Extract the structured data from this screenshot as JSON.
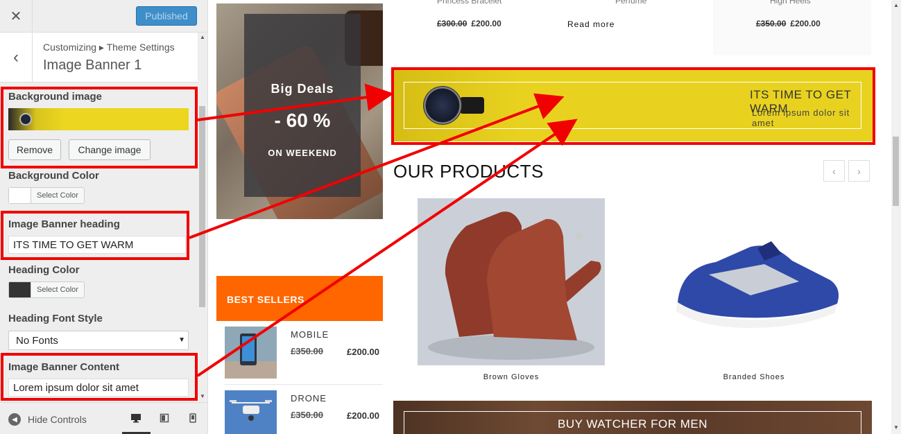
{
  "customizer": {
    "close_glyph": "✕",
    "publish_label": "Published",
    "back_glyph": "‹",
    "breadcrumb": "Customizing ▸ Theme Settings",
    "section_title": "Image Banner 1",
    "controls": {
      "bg_image_label": "Background image",
      "remove_label": "Remove",
      "change_image_label": "Change image",
      "bg_color_label": "Background Color",
      "bg_color_btn": "Select Color",
      "heading_label": "Image Banner heading",
      "heading_value": "ITS TIME TO GET WARM",
      "heading_color_label": "Heading Color",
      "heading_color_btn": "Select Color",
      "font_style_label": "Heading Font Style",
      "font_style_value": "No Fonts",
      "content_label": "Image Banner Content",
      "content_value": "Lorem ipsum dolor sit amet"
    },
    "footer": {
      "hide_controls_label": "Hide Controls"
    },
    "colors": {
      "accent": "#3e8ec9",
      "annotation_red": "#f10000",
      "heading_color_swatch": "#333333",
      "bg_color_swatch": "#ffffff"
    }
  },
  "preview": {
    "top_products": [
      {
        "name": "Princess Bracelet",
        "old_price": "£300.00",
        "new_price": "£200.00"
      },
      {
        "name": "Perfume",
        "action": "Read more"
      },
      {
        "name": "High Heels",
        "old_price": "£350.00",
        "new_price": "£200.00"
      }
    ],
    "promo": {
      "title": "Big Deals",
      "discount": "- 60 %",
      "subtitle": "ON WEEKEND"
    },
    "image_banner": {
      "heading": "ITS TIME TO GET WARM",
      "content": "Lorem ipsum dolor sit amet",
      "bg_color": "#e8d21f"
    },
    "best_sellers": {
      "title": "BEST SELLERS",
      "items": [
        {
          "name": "MOBILE",
          "old_price": "£350.00",
          "new_price": "£200.00"
        },
        {
          "name": "DRONE",
          "old_price": "£350.00",
          "new_price": "£200.00"
        }
      ],
      "color": "#ff6600"
    },
    "our_products": {
      "title": "OUR PRODUCTS",
      "prev_glyph": "‹",
      "next_glyph": "›",
      "items": [
        {
          "name": "Brown Gloves"
        },
        {
          "name": "Branded Shoes"
        }
      ]
    },
    "bottom_banner": {
      "text": "BUY WATCHER FOR MEN"
    }
  }
}
